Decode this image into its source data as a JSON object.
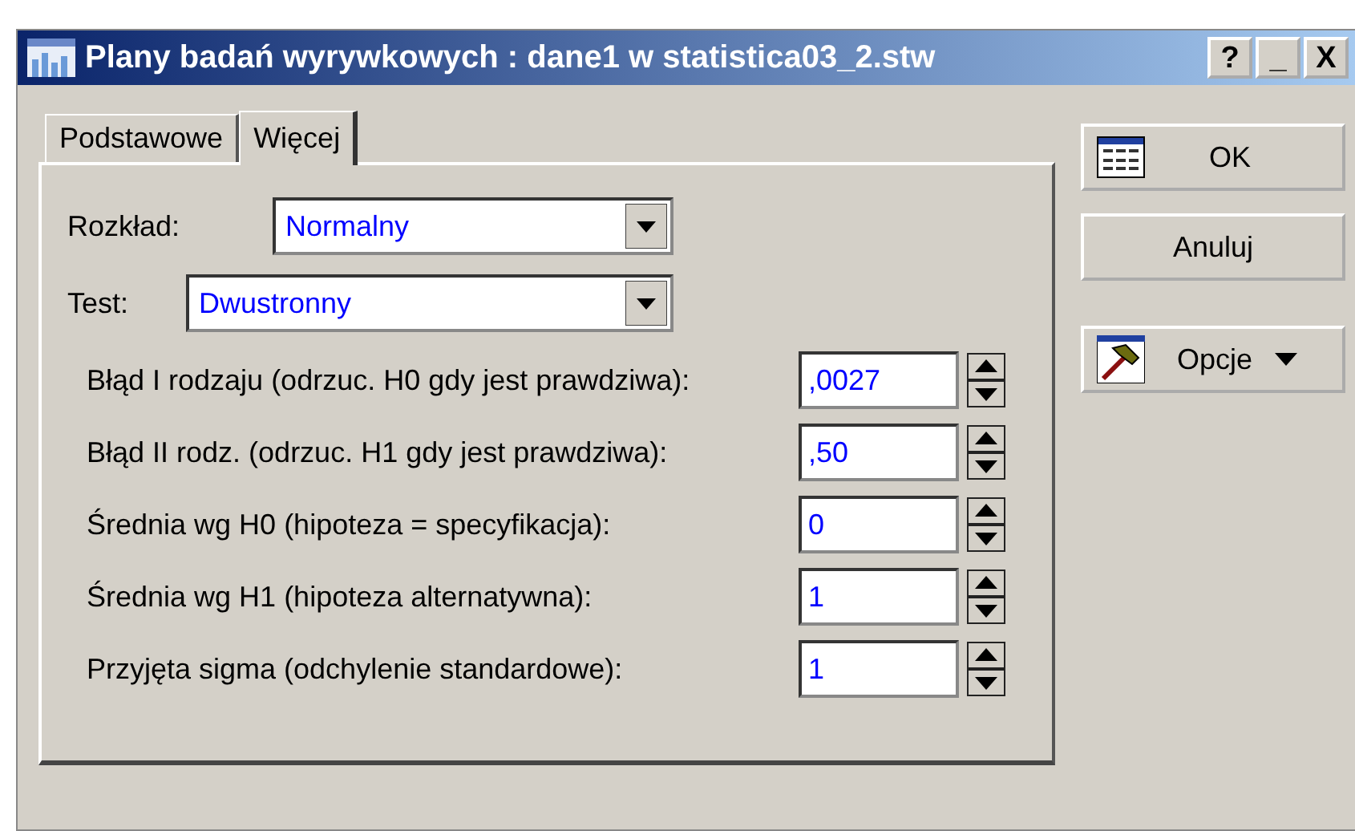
{
  "window": {
    "title": "Plany badań wyrywkowych : dane1 w statistica03_2.stw"
  },
  "title_buttons": [
    "?",
    "_",
    "X"
  ],
  "tabs": [
    {
      "label": "Podstawowe",
      "selected": false
    },
    {
      "label": "Więcej",
      "selected": true
    }
  ],
  "dropdowns": [
    {
      "label": "Rozkład:",
      "value": "Normalny"
    },
    {
      "label": "Test:",
      "value": "Dwustronny"
    }
  ],
  "fields": [
    {
      "label": "Błąd I rodzaju (odrzuc. H0 gdy jest prawdziwa):",
      "value": ",0027"
    },
    {
      "label": "Błąd II rodz. (odrzuc. H1 gdy jest prawdziwa):",
      "value": ",50"
    },
    {
      "label": "Średnia wg H0 (hipoteza = specyfikacja):",
      "value": "0"
    },
    {
      "label": "Średnia wg H1 (hipoteza alternatywna):",
      "value": "1"
    },
    {
      "label": "Przyjęta sigma (odchylenie standardowe):",
      "value": "1"
    }
  ],
  "buttons": [
    {
      "kind": "ok",
      "label": "OK"
    },
    {
      "kind": "cancel",
      "label": "Anuluj"
    },
    {
      "kind": "options",
      "label": "Opcje"
    }
  ]
}
